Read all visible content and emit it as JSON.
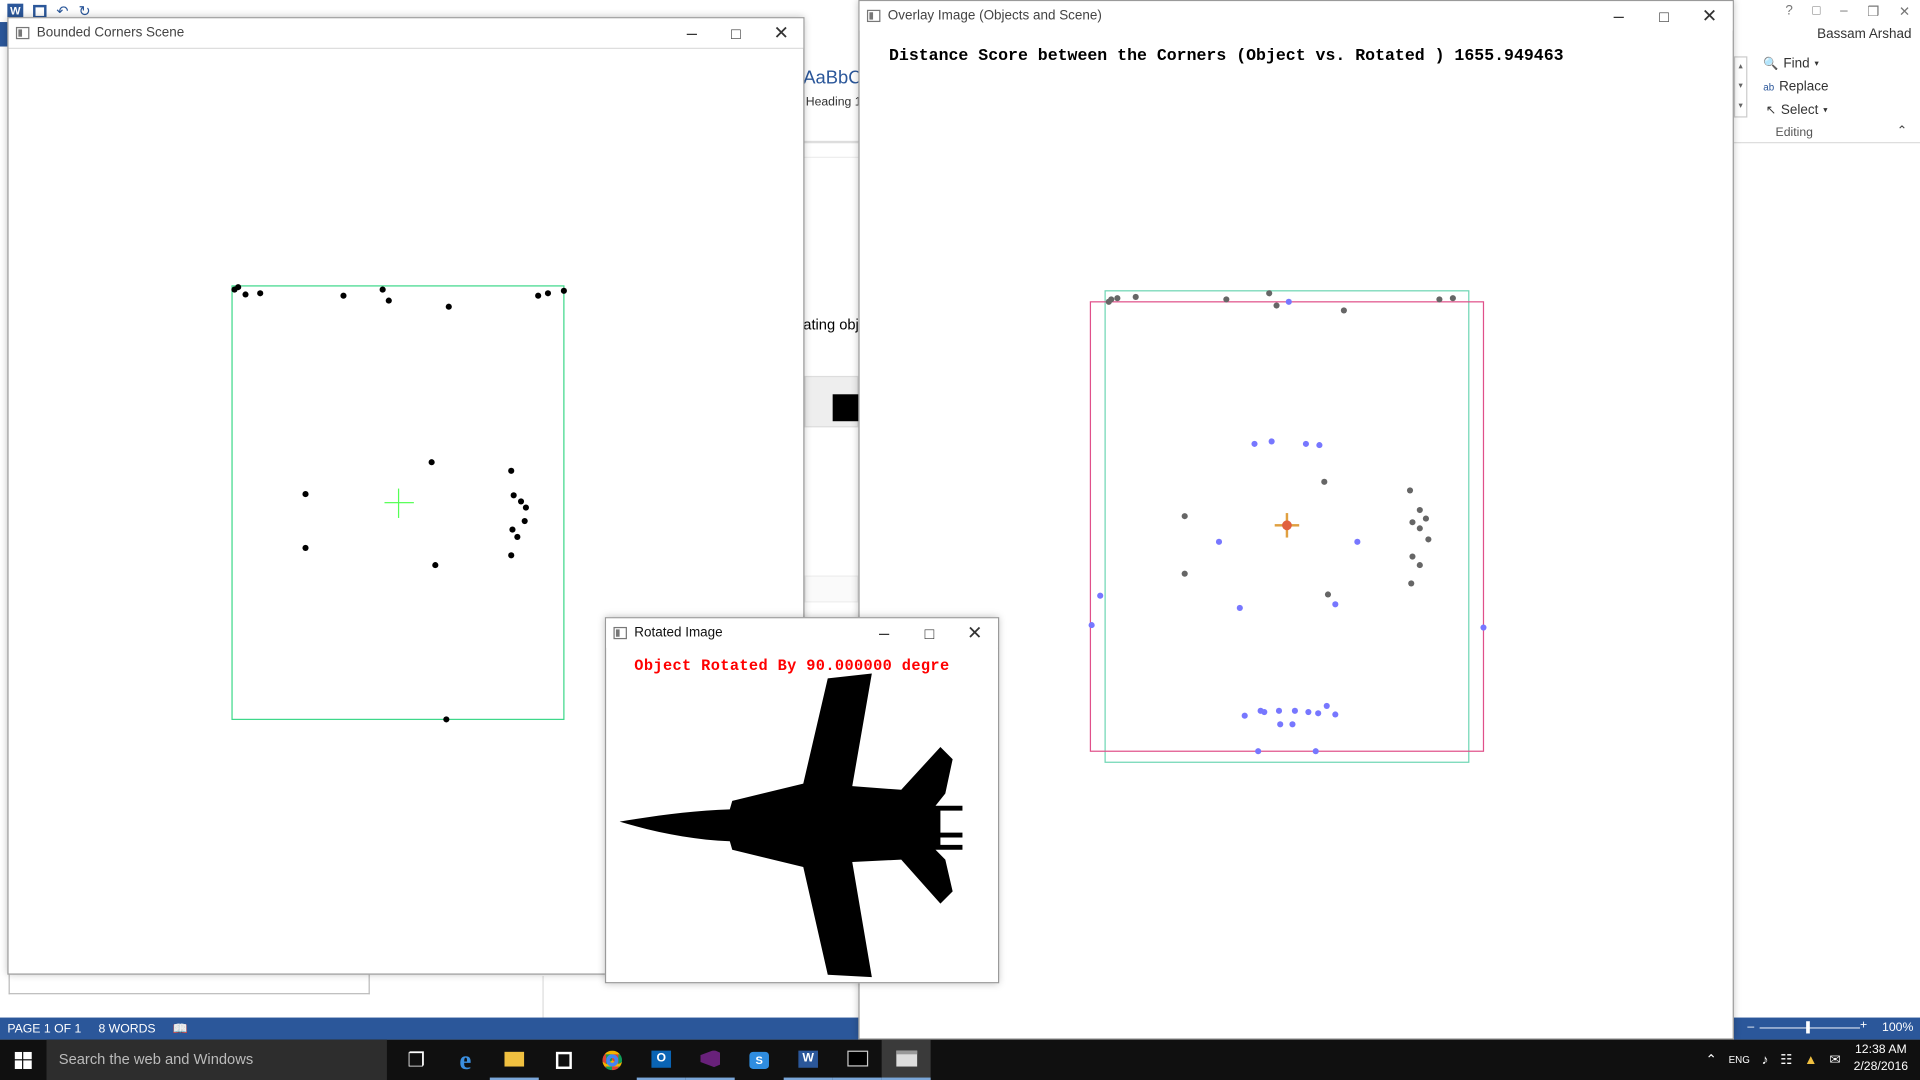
{
  "word": {
    "user": "Bassam Arshad",
    "style_sample": "AaBbC",
    "style_name": "Heading 1",
    "doc_text_fragment": "ating obje",
    "editing": {
      "find": "Find",
      "replace": "Replace",
      "select": "Select",
      "group": "Editing"
    },
    "status": {
      "page": "PAGE 1 OF 1",
      "words": "8 WORDS",
      "zoom": "100%"
    },
    "help": "?"
  },
  "windows": {
    "bounded": {
      "title": "Bounded Corners Scene"
    },
    "overlay": {
      "title": "Overlay Image (Objects and Scene)",
      "score_text": "Distance Score between the Corners (Object vs. Rotated ) 1655.949463"
    },
    "rotated": {
      "title": "Rotated Image",
      "caption": "Object Rotated By 90.000000 degre"
    }
  },
  "taskbar": {
    "search_placeholder": "Search the web and Windows",
    "time": "12:38 AM",
    "date": "2/28/2016",
    "lang": "ENG"
  },
  "colors": {
    "word_blue": "#2b579a",
    "box_green": "#3ed88a",
    "box_pink": "#e0508a",
    "caption_red": "#ff0000",
    "blue_dot": "#7777ff"
  }
}
